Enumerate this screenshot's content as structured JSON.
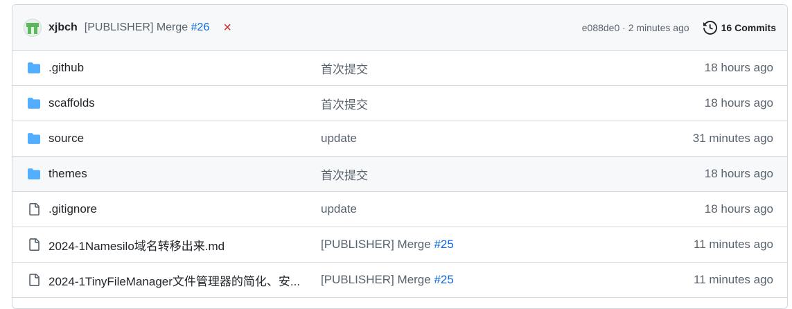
{
  "header": {
    "author": "xjbch",
    "message_prefix": "[PUBLISHER] Merge",
    "message_link": "#26",
    "status": "×",
    "meta": "e088de0 · 2 minutes ago",
    "commits_label": "16 Commits"
  },
  "colors": {
    "folder": "#54aeff",
    "link": "#0969da",
    "fail": "#cf222e"
  },
  "rows": [
    {
      "type": "folder",
      "icon": "folder-icon",
      "name": ".github",
      "msg": "首次提交",
      "msg_link": "",
      "age": "18 hours ago"
    },
    {
      "type": "folder",
      "icon": "folder-icon",
      "name": "scaffolds",
      "msg": "首次提交",
      "msg_link": "",
      "age": "18 hours ago"
    },
    {
      "type": "folder",
      "icon": "folder-icon",
      "name": "source",
      "msg": "update",
      "msg_link": "",
      "age": "31 minutes ago"
    },
    {
      "type": "folder",
      "icon": "folder-icon",
      "name": "themes",
      "msg": "首次提交",
      "msg_link": "",
      "age": "18 hours ago"
    },
    {
      "type": "file",
      "icon": "file-icon",
      "name": ".gitignore",
      "msg": "update",
      "msg_link": "",
      "age": "18 hours ago"
    },
    {
      "type": "file",
      "icon": "file-icon",
      "name": "2024-1Namesilo域名转移出来.md",
      "msg": "[PUBLISHER] Merge ",
      "msg_link": "#25",
      "age": "11 minutes ago"
    },
    {
      "type": "file",
      "icon": "file-icon",
      "name": "2024-1TinyFileManager文件管理器的简化、安...",
      "msg": "[PUBLISHER] Merge ",
      "msg_link": "#25",
      "age": "11 minutes ago"
    }
  ]
}
